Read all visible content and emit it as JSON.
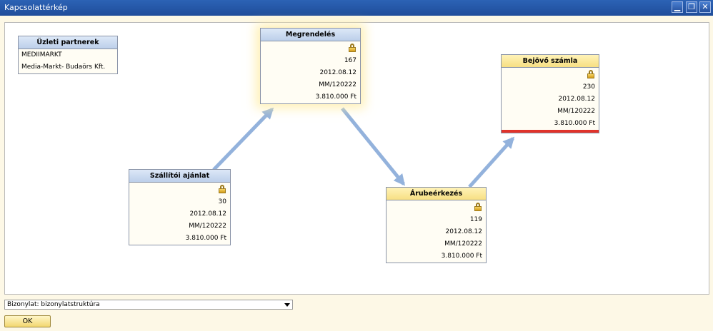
{
  "window": {
    "title": "Kapcsolattérkép",
    "controls": [
      "minimize-icon",
      "restore-icon",
      "close-icon"
    ]
  },
  "nodes": {
    "partner": {
      "header": "Üzleti partnerek",
      "code": "MEDIIMARKT",
      "name": "Media-Markt- Budaörs Kft."
    },
    "megrendeles": {
      "header": "Megrendelés",
      "doc_number": "167",
      "date": "2012.08.12",
      "reference": "MM/120222",
      "amount": "3.810.000 Ft",
      "icon": "lock-icon"
    },
    "szallitoi_ajanlat": {
      "header": "Szállítói ajánlat",
      "doc_number": "30",
      "date": "2012.08.12",
      "reference": "MM/120222",
      "amount": "3.810.000 Ft",
      "icon": "lock-icon"
    },
    "arubeerkezes": {
      "header": "Árubeérkezés",
      "doc_number": "119",
      "date": "2012.08.12",
      "reference": "MM/120222",
      "amount": "3.810.000 Ft",
      "icon": "lock-icon"
    },
    "bejovo_szamla": {
      "header": "Bejövő számla",
      "doc_number": "230",
      "date": "2012.08.12",
      "reference": "MM/120222",
      "amount": "3.810.000 Ft",
      "icon": "lock-open-icon"
    }
  },
  "footer": {
    "dropdown_value": "Bizonylat: bizonylatstruktúra",
    "ok_label": "OK"
  },
  "colors": {
    "titlebar": "#1f4d9a",
    "arrow": "#93b2dc",
    "blue_header": "#bccfea",
    "yellow_header": "#f7df83",
    "status_bar": "#e0332b"
  }
}
